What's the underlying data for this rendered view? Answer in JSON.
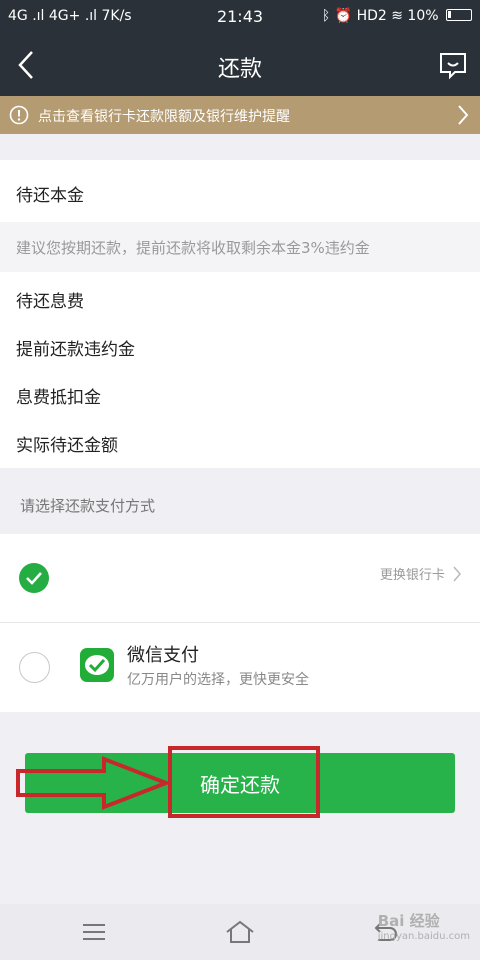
{
  "status_bar": {
    "left": "4G .ıl 4G+ .ıl 7K/s",
    "time": "21:43",
    "right": "ᛒ ⏰ HD2 ≋ 10%"
  },
  "nav": {
    "title": "还款"
  },
  "notice": {
    "text": "点击查看银行卡还款限额及银行维护提醒"
  },
  "summary": {
    "principal_label": "待还本金",
    "advice_text": "建议您按期还款，提前还款将收取剩余本金3%违约金",
    "interest_label": "待还息费",
    "penalty_label": "提前还款违约金",
    "deduction_label": "息费抵扣金",
    "actual_label": "实际待还金额"
  },
  "payment": {
    "section_hint": "请选择还款支付方式",
    "bank_card": {
      "change_label": "更换银行卡"
    },
    "wechat": {
      "title": "微信支付",
      "subtitle": "亿万用户的选择，更快更安全"
    }
  },
  "confirm_button": {
    "label": "确定还款"
  },
  "watermark": {
    "text": "Bai 经验",
    "sub": "jingyan.baidu.com"
  },
  "colors": {
    "status_bar_bg": "#2a3138",
    "notice_bg": "#b49b72",
    "primary_green": "#27b24a",
    "annotation_red": "#c8282c"
  }
}
